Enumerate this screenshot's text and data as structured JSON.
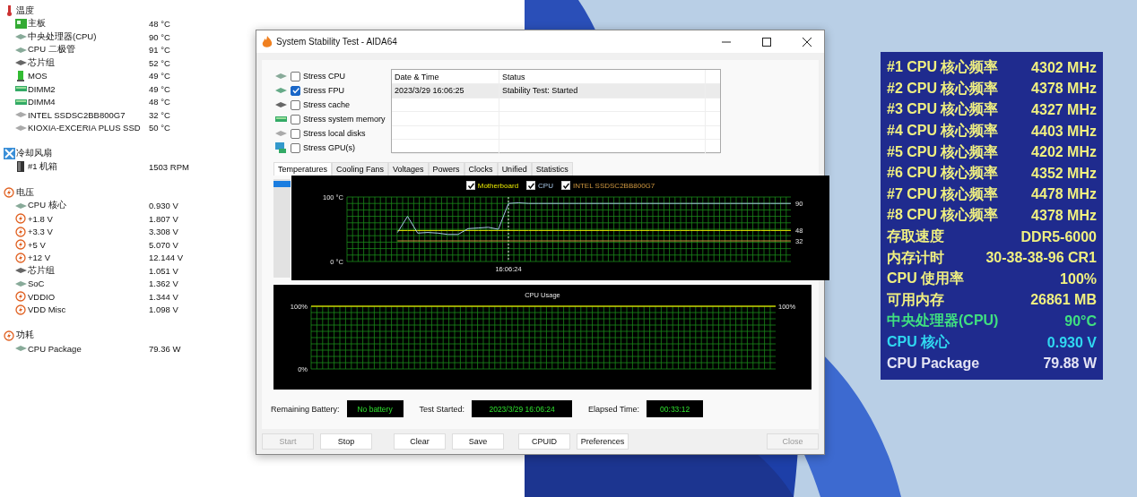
{
  "sensor_tree": [
    {
      "label": "温度",
      "kind": "thermometer",
      "children": [
        {
          "label": "主板",
          "value": "48 °C",
          "kind": "board"
        },
        {
          "label": "中央处理器(CPU)",
          "value": "90 °C",
          "kind": "chip"
        },
        {
          "label": "CPU 二极管",
          "value": "91 °C",
          "kind": "chip"
        },
        {
          "label": "芯片组",
          "value": "52 °C",
          "kind": "chipset"
        },
        {
          "label": "MOS",
          "value": "49 °C",
          "kind": "mos"
        },
        {
          "label": "DIMM2",
          "value": "49 °C",
          "kind": "dimm"
        },
        {
          "label": "DIMM4",
          "value": "48 °C",
          "kind": "dimm"
        },
        {
          "label": "INTEL SSDSC2BB800G7",
          "value": "32 °C",
          "kind": "disk"
        },
        {
          "label": "KIOXIA-EXCERIA PLUS SSD",
          "value": "50 °C",
          "kind": "disk"
        }
      ]
    },
    {
      "label": "冷却风扇",
      "kind": "fan",
      "children": [
        {
          "label": "#1 机箱",
          "value": "1503 RPM",
          "kind": "case"
        }
      ]
    },
    {
      "label": "电压",
      "kind": "bolt",
      "children": [
        {
          "label": "CPU 核心",
          "value": "0.930 V",
          "kind": "chip"
        },
        {
          "label": "+1.8 V",
          "value": "1.807 V",
          "kind": "bolt"
        },
        {
          "label": "+3.3 V",
          "value": "3.308 V",
          "kind": "bolt"
        },
        {
          "label": "+5 V",
          "value": "5.070 V",
          "kind": "bolt"
        },
        {
          "label": "+12 V",
          "value": "12.144 V",
          "kind": "bolt"
        },
        {
          "label": "芯片组",
          "value": "1.051 V",
          "kind": "chipset"
        },
        {
          "label": "SoC",
          "value": "1.362 V",
          "kind": "chip"
        },
        {
          "label": "VDDIO",
          "value": "1.344 V",
          "kind": "bolt"
        },
        {
          "label": "VDD Misc",
          "value": "1.098 V",
          "kind": "bolt"
        }
      ]
    },
    {
      "label": "功耗",
      "kind": "bolt",
      "children": [
        {
          "label": "CPU Package",
          "value": "79.36 W",
          "kind": "chip"
        }
      ]
    }
  ],
  "window": {
    "title": "System Stability Test - AIDA64"
  },
  "stress_options": [
    {
      "label": "Stress CPU",
      "checked": false,
      "kind": "chip"
    },
    {
      "label": "Stress FPU",
      "checked": true,
      "kind": "fpu"
    },
    {
      "label": "Stress cache",
      "checked": false,
      "kind": "chipset"
    },
    {
      "label": "Stress system memory",
      "checked": false,
      "kind": "dimm"
    },
    {
      "label": "Stress local disks",
      "checked": false,
      "kind": "disk"
    },
    {
      "label": "Stress GPU(s)",
      "checked": false,
      "kind": "gpu"
    }
  ],
  "log": {
    "columns": [
      "Date & Time",
      "Status"
    ],
    "rows": [
      {
        "cells": [
          "2023/3/29 16:06:25",
          "Stability Test: Started"
        ],
        "selected": true
      }
    ]
  },
  "tabs": [
    {
      "label": "Temperatures",
      "selected": true
    },
    {
      "label": "Cooling Fans",
      "selected": false
    },
    {
      "label": "Voltages",
      "selected": false
    },
    {
      "label": "Powers",
      "selected": false
    },
    {
      "label": "Clocks",
      "selected": false
    },
    {
      "label": "Unified",
      "selected": false
    },
    {
      "label": "Statistics",
      "selected": false
    }
  ],
  "temperature_graph": {
    "legend": [
      {
        "checked": true
      },
      {
        "checked": true
      },
      {
        "checked": true
      }
    ],
    "end_labels": [
      "90",
      "48",
      "32"
    ],
    "chart_data": {
      "type": "line",
      "categories": [
        null,
        null,
        null,
        null,
        null,
        null,
        null,
        null,
        null,
        null,
        null,
        null,
        null,
        null,
        null,
        null,
        null,
        null,
        null,
        null,
        null,
        null,
        null,
        null,
        null,
        null,
        null,
        null,
        null,
        null,
        null,
        null,
        null,
        null,
        null,
        null,
        null,
        null,
        null,
        null,
        null,
        null,
        null,
        null,
        null
      ],
      "series": [
        {
          "name": "Motherboard",
          "color": "#e8e800",
          "values": [
            null,
            null,
            null,
            null,
            null,
            48,
            48,
            48,
            48,
            48,
            48,
            48,
            48,
            48,
            48,
            48,
            48,
            48,
            48,
            48,
            48,
            48,
            48,
            48,
            48,
            48,
            48,
            48,
            48,
            48,
            48,
            48,
            48,
            48,
            48,
            48,
            48,
            48,
            48,
            48,
            48,
            48,
            48,
            48,
            48
          ]
        },
        {
          "name": "CPU",
          "color": "#a8c8e8",
          "values": [
            null,
            null,
            null,
            null,
            null,
            45,
            70,
            44,
            45,
            44,
            42,
            42,
            51,
            52,
            53,
            50,
            90,
            91,
            90,
            90,
            90,
            90,
            90,
            90,
            90,
            90,
            90,
            90,
            90,
            90,
            90,
            90,
            90,
            90,
            90,
            90,
            90,
            90,
            90,
            90,
            90,
            90,
            90,
            90,
            90
          ]
        },
        {
          "name": "INTEL SSDSC2BB800G7",
          "color": "#d09840",
          "values": [
            null,
            null,
            null,
            null,
            null,
            32,
            32,
            32,
            32,
            32,
            32,
            32,
            32,
            32,
            32,
            32,
            32,
            32,
            32,
            32,
            32,
            32,
            32,
            32,
            32,
            32,
            32,
            32,
            32,
            32,
            32,
            32,
            32,
            32,
            32,
            32,
            32,
            32,
            32,
            32,
            32,
            32,
            32,
            32,
            32
          ]
        }
      ],
      "ylim": [
        0,
        100
      ],
      "yticks": [
        {
          "value": 0,
          "label": "0 °C"
        },
        {
          "value": 100,
          "label": "100 °C"
        }
      ],
      "grid": true,
      "annotations": [
        {
          "text": "16:06:24"
        }
      ]
    }
  },
  "usage_graph": {
    "end_labels": [
      "100%"
    ],
    "chart_data": {
      "type": "line",
      "title": "CPU Usage",
      "categories": [
        null,
        null,
        null,
        null,
        null,
        null,
        null,
        null,
        null,
        null
      ],
      "series": [
        {
          "color": "#c8c800",
          "values": [
            100,
            100,
            100,
            100,
            100,
            100,
            100,
            100,
            100,
            100
          ]
        }
      ],
      "ylim": [
        0,
        100
      ],
      "grid": true,
      "yticks": [
        {
          "value": 0,
          "label": "0%"
        },
        {
          "value": 100,
          "label": "100%"
        }
      ]
    }
  },
  "status": [
    {
      "label": "Remaining Battery:",
      "value": "No battery"
    },
    {
      "label": "Test Started:",
      "value": "2023/3/29 16:06:24"
    },
    {
      "label": "Elapsed Time:",
      "value": "00:33:12"
    }
  ],
  "buttons": [
    {
      "label": "Start",
      "disabled": true
    },
    {
      "label": "Stop",
      "disabled": false
    },
    {
      "label": "Clear",
      "disabled": false
    },
    {
      "label": "Save",
      "disabled": false
    },
    {
      "label": "CPUID",
      "disabled": false
    },
    {
      "label": "Preferences",
      "disabled": false
    },
    {
      "label": "Close",
      "disabled": true
    }
  ],
  "osd": [
    {
      "label": "#1 CPU 核心频率",
      "value": "4302 MHz",
      "color": "#f0f080"
    },
    {
      "label": "#2 CPU 核心频率",
      "value": "4378 MHz",
      "color": "#f0f080"
    },
    {
      "label": "#3 CPU 核心频率",
      "value": "4327 MHz",
      "color": "#f0f080"
    },
    {
      "label": "#4 CPU 核心频率",
      "value": "4403 MHz",
      "color": "#f0f080"
    },
    {
      "label": "#5 CPU 核心频率",
      "value": "4202 MHz",
      "color": "#f0f080"
    },
    {
      "label": "#6 CPU 核心频率",
      "value": "4352 MHz",
      "color": "#f0f080"
    },
    {
      "label": "#7 CPU 核心频率",
      "value": "4478 MHz",
      "color": "#f0f080"
    },
    {
      "label": "#8 CPU 核心频率",
      "value": "4378 MHz",
      "color": "#f0f080"
    },
    {
      "label": "存取速度",
      "value": "DDR5-6000",
      "color": "#f0f080"
    },
    {
      "label": "内存计时",
      "value": "30-38-38-96 CR1",
      "color": "#f0f080"
    },
    {
      "label": "CPU 使用率",
      "value": "100%",
      "color": "#f0f080"
    },
    {
      "label": "可用内存",
      "value": "26861 MB",
      "color": "#f0f080"
    },
    {
      "label": "中央处理器(CPU)",
      "value": "90°C",
      "color": "#40e080"
    },
    {
      "label": "CPU 核心",
      "value": "0.930 V",
      "color": "#30d8f0"
    },
    {
      "label": "CPU Package",
      "value": "79.88 W",
      "color": "#e4e4f4"
    }
  ]
}
